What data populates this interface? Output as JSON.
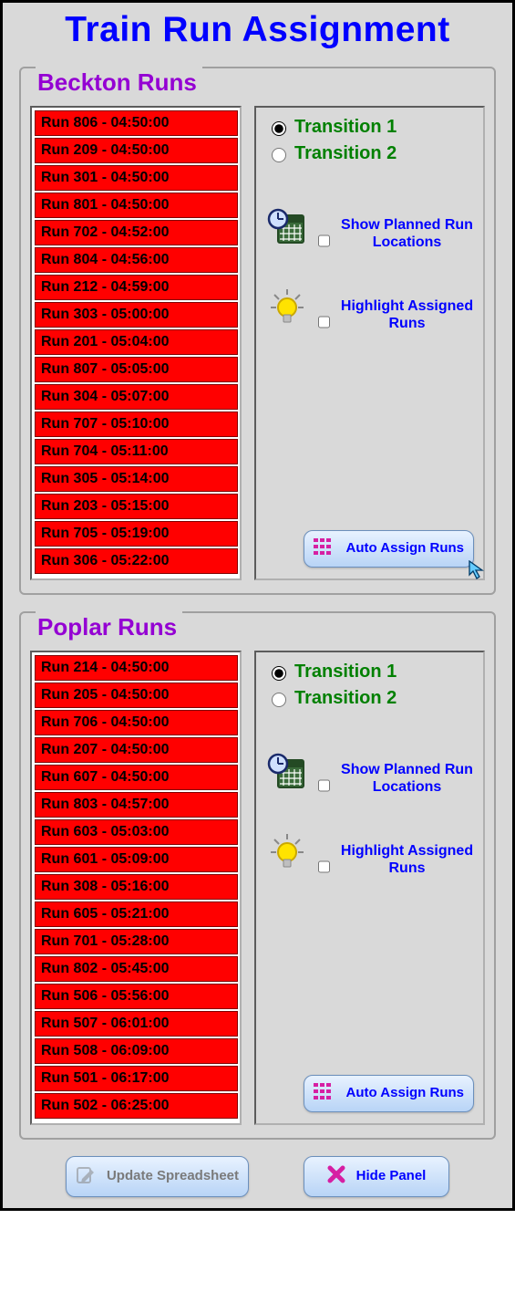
{
  "title": "Train Run Assignment",
  "groups": {
    "beckton": {
      "title": "Beckton Runs",
      "runs": [
        "Run 806 - 04:50:00",
        "Run 209 - 04:50:00",
        "Run 301 - 04:50:00",
        "Run 801 - 04:50:00",
        "Run 702 - 04:52:00",
        "Run 804 - 04:56:00",
        "Run 212 - 04:59:00",
        "Run 303 - 05:00:00",
        "Run 201 - 05:04:00",
        "Run 807 - 05:05:00",
        "Run 304 - 05:07:00",
        "Run 707 - 05:10:00",
        "Run 704 - 05:11:00",
        "Run 305 - 05:14:00",
        "Run 203 - 05:15:00",
        "Run 705 - 05:19:00",
        "Run 306 - 05:22:00"
      ],
      "transition1": "Transition 1",
      "transition2": "Transition 2",
      "selected_transition": 1,
      "show_planned": "Show Planned Run Locations",
      "highlight": "Highlight Assigned Runs",
      "auto_assign": "Auto Assign Runs"
    },
    "poplar": {
      "title": "Poplar Runs",
      "runs": [
        "Run 214 - 04:50:00",
        "Run 205 - 04:50:00",
        "Run 706 - 04:50:00",
        "Run 207 - 04:50:00",
        "Run 607 - 04:50:00",
        "Run 803 - 04:57:00",
        "Run 603 - 05:03:00",
        "Run 601 - 05:09:00",
        "Run 308 - 05:16:00",
        "Run 605 - 05:21:00",
        "Run 701 - 05:28:00",
        "Run 802 - 05:45:00",
        "Run 506 - 05:56:00",
        "Run 507 - 06:01:00",
        "Run 508 - 06:09:00",
        "Run 501 - 06:17:00",
        "Run 502 - 06:25:00"
      ],
      "transition1": "Transition 1",
      "transition2": "Transition 2",
      "selected_transition": 1,
      "show_planned": "Show Planned Run Locations",
      "highlight": "Highlight Assigned Runs",
      "auto_assign": "Auto Assign Runs"
    }
  },
  "footer": {
    "update": "Update Spreadsheet",
    "hide": "Hide Panel"
  }
}
